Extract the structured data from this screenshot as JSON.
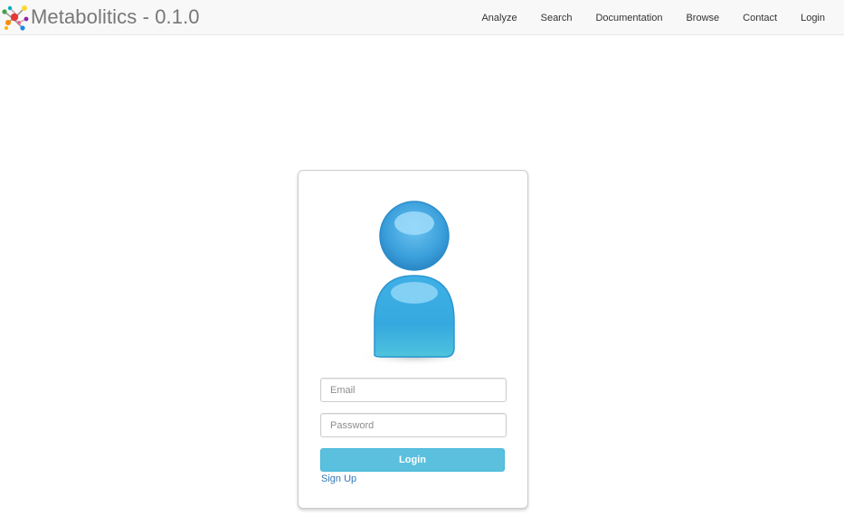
{
  "navbar": {
    "brand": "Metabolitics - 0.1.0",
    "logo_icon": "molecule-logo-icon",
    "links": [
      "Analyze",
      "Search",
      "Documentation",
      "Browse",
      "Contact",
      "Login"
    ]
  },
  "login": {
    "avatar_icon": "user-avatar-icon",
    "email_placeholder": "Email",
    "password_placeholder": "Password",
    "login_label": "Login",
    "signup_label": "Sign Up"
  },
  "colors": {
    "navbar_bg": "#f8f8f8",
    "button_bg": "#5bc0de",
    "link": "#337ab7",
    "avatar_blue": "#3ea8dd"
  }
}
